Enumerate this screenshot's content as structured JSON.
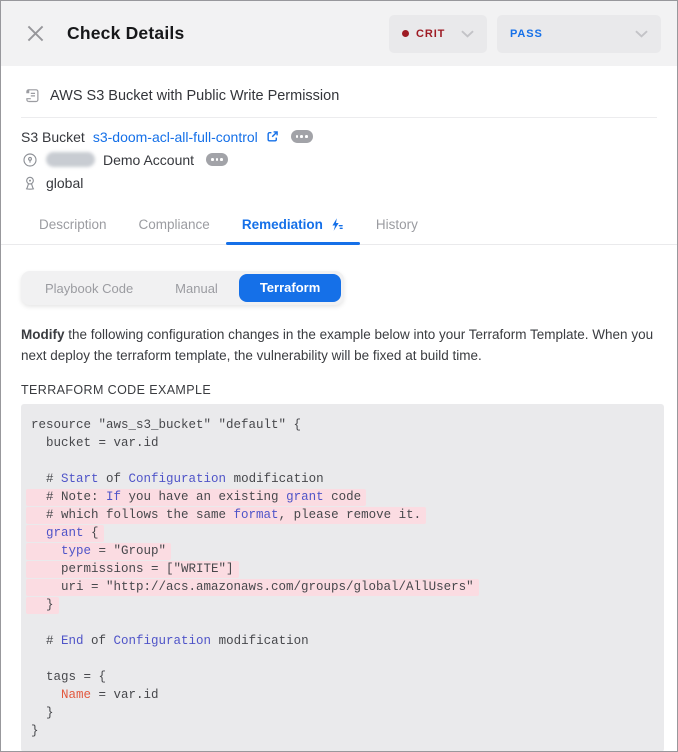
{
  "colors": {
    "accent": "#1570e8",
    "crit": "#9e1b24",
    "code_blue": "#4f54c8",
    "code_orange": "#e2593f",
    "highlight_pink": "#fbdce2"
  },
  "header": {
    "title": "Check Details",
    "severity": {
      "label": "CRIT"
    },
    "status": {
      "label": "PASS"
    }
  },
  "resource": {
    "title": "AWS S3 Bucket with Public Write Permission",
    "bucket_label": "S3 Bucket",
    "bucket_link": "s3-doom-acl-all-full-control",
    "account_name": "Demo Account",
    "region": "global"
  },
  "tabs": {
    "items": [
      {
        "label": "Description"
      },
      {
        "label": "Compliance"
      },
      {
        "label": "Remediation"
      },
      {
        "label": "History"
      }
    ],
    "active": "Remediation"
  },
  "subtabs": {
    "items": [
      {
        "label": "Playbook Code"
      },
      {
        "label": "Manual"
      },
      {
        "label": "Terraform"
      }
    ],
    "active": "Terraform"
  },
  "remediation": {
    "instruction_bold": "Modify",
    "instruction_rest": " the following configuration changes in the example below into your Terraform Template. When you next deploy the terraform template, the vulnerability will be fixed at build time.",
    "code_label": "TERRAFORM CODE EXAMPLE"
  },
  "code": {
    "lines": [
      {
        "hl": false,
        "seg": [
          [
            "resource \"aws_s3_bucket\" \"default\" {",
            "d"
          ]
        ]
      },
      {
        "hl": false,
        "seg": [
          [
            "  bucket = var.id",
            "d"
          ]
        ]
      },
      {
        "hl": false,
        "seg": [
          [
            "",
            "d"
          ]
        ]
      },
      {
        "hl": false,
        "seg": [
          [
            "  # ",
            "d"
          ],
          [
            "Start",
            "b"
          ],
          [
            " of ",
            "d"
          ],
          [
            "Configuration",
            "b"
          ],
          [
            " modification",
            "d"
          ]
        ]
      },
      {
        "hl": true,
        "seg": [
          [
            "  # Note: ",
            "d"
          ],
          [
            "If",
            "b"
          ],
          [
            " you have an existing ",
            "d"
          ],
          [
            "grant",
            "b"
          ],
          [
            " code",
            "d"
          ]
        ]
      },
      {
        "hl": true,
        "seg": [
          [
            "  # which follows the same ",
            "d"
          ],
          [
            "format",
            "b"
          ],
          [
            ", please remove it.",
            "d"
          ]
        ]
      },
      {
        "hl": true,
        "seg": [
          [
            "  ",
            "d"
          ],
          [
            "grant",
            "b"
          ],
          [
            " {",
            "d"
          ]
        ]
      },
      {
        "hl": true,
        "seg": [
          [
            "    ",
            "d"
          ],
          [
            "type",
            "b"
          ],
          [
            " = \"Group\"",
            "d"
          ]
        ]
      },
      {
        "hl": true,
        "seg": [
          [
            "    permissions = [\"WRITE\"]",
            "d"
          ]
        ]
      },
      {
        "hl": true,
        "seg": [
          [
            "    uri = \"http://acs.amazonaws.com/groups/global/AllUsers\"",
            "d"
          ]
        ]
      },
      {
        "hl": true,
        "seg": [
          [
            "  }",
            "d"
          ]
        ]
      },
      {
        "hl": false,
        "seg": [
          [
            "",
            "d"
          ]
        ]
      },
      {
        "hl": false,
        "seg": [
          [
            "  # ",
            "d"
          ],
          [
            "End",
            "b"
          ],
          [
            " of ",
            "d"
          ],
          [
            "Configuration",
            "b"
          ],
          [
            " modification",
            "d"
          ]
        ]
      },
      {
        "hl": false,
        "seg": [
          [
            "",
            "d"
          ]
        ]
      },
      {
        "hl": false,
        "seg": [
          [
            "  tags = {",
            "d"
          ]
        ]
      },
      {
        "hl": false,
        "seg": [
          [
            "    ",
            "d"
          ],
          [
            "Name",
            "o"
          ],
          [
            " = var.id",
            "d"
          ]
        ]
      },
      {
        "hl": false,
        "seg": [
          [
            "  }",
            "d"
          ]
        ]
      },
      {
        "hl": false,
        "seg": [
          [
            "}",
            "d"
          ]
        ]
      }
    ]
  }
}
